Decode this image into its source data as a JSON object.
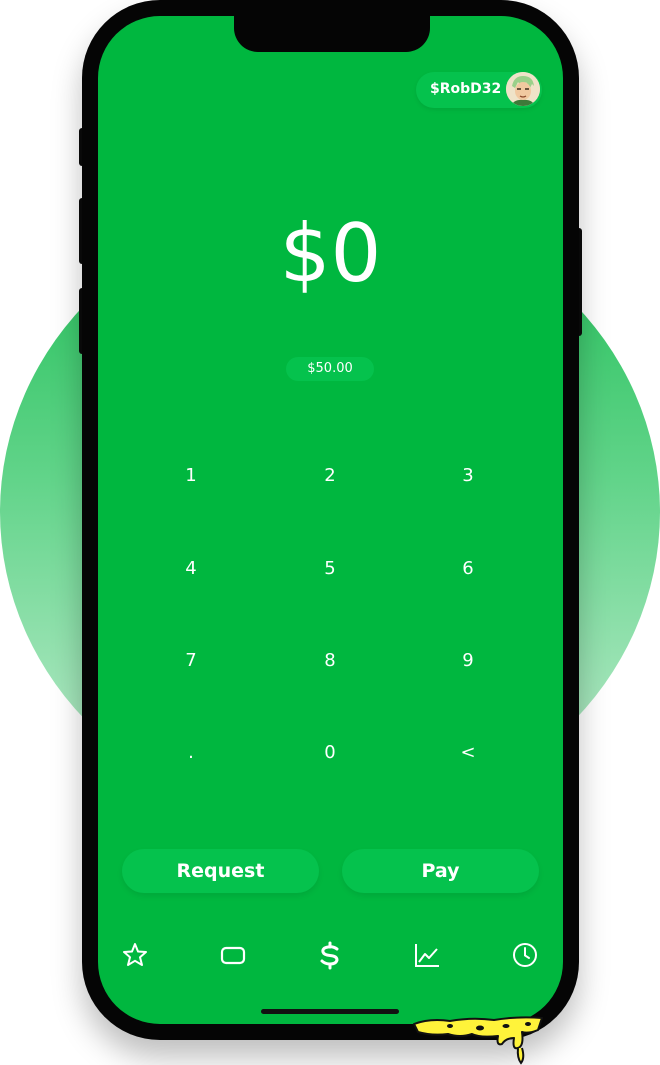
{
  "colors": {
    "screen": "#00b73f",
    "pill": "#05c24d",
    "text": "#ffffff",
    "phone_frame": "#050505",
    "accent_splat": "#fff33a"
  },
  "header": {
    "cashtag": "$RobD32",
    "avatar_icon": "user-avatar"
  },
  "amount": {
    "value": "$0"
  },
  "balance": {
    "label": "$50.00"
  },
  "keypad": {
    "keys": [
      "1",
      "2",
      "3",
      "4",
      "5",
      "6",
      "7",
      "8",
      "9",
      ".",
      "0",
      "<"
    ]
  },
  "actions": {
    "request_label": "Request",
    "pay_label": "Pay"
  },
  "nav": {
    "items": [
      {
        "icon": "star-icon",
        "label": "Favorites"
      },
      {
        "icon": "card-icon",
        "label": "Card"
      },
      {
        "icon": "dollar-icon",
        "label": "Pay"
      },
      {
        "icon": "chart-icon",
        "label": "Investing"
      },
      {
        "icon": "clock-icon",
        "label": "Activity"
      }
    ]
  }
}
